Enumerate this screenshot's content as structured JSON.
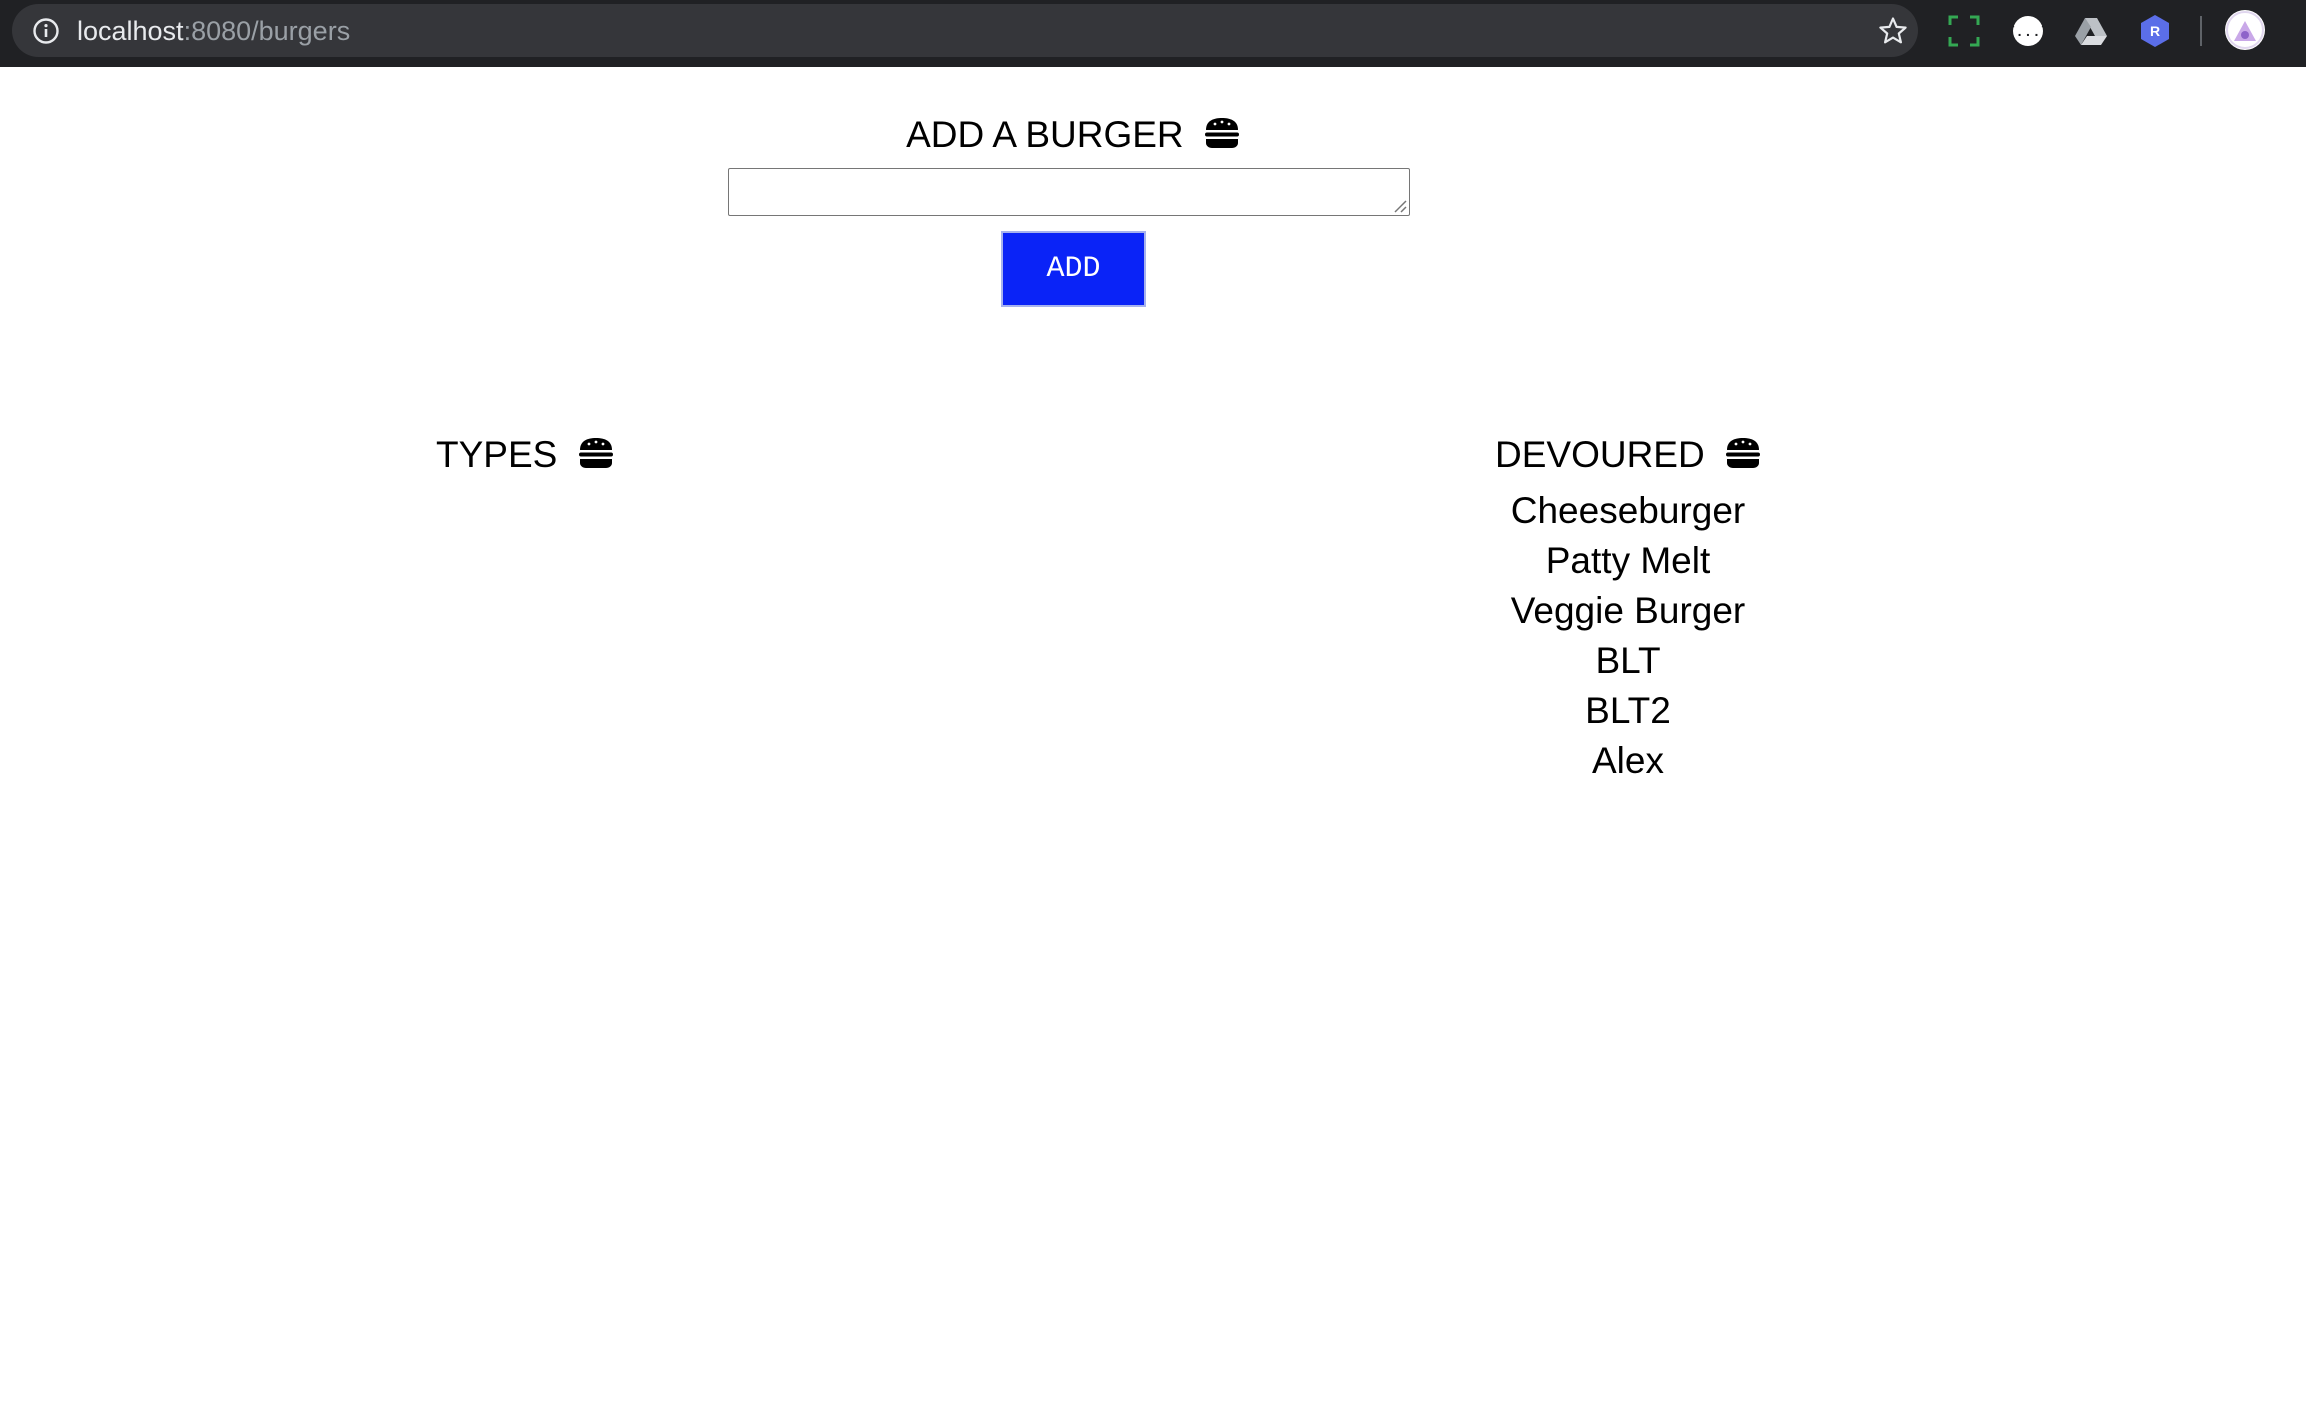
{
  "browser": {
    "url_host": "localhost",
    "url_path": ":8080/burgers",
    "extensions": [
      "screenshot-extension-icon",
      "json-viewer-icon",
      "google-drive-icon",
      "r-extension-icon"
    ],
    "extension_r_letter": "R",
    "accent_colors": {
      "chrome_bg": "#202124",
      "omnibox_bg": "#35363a",
      "ext_r": "#5b6ee8"
    }
  },
  "add_section": {
    "heading": "ADD A BURGER",
    "input_value": "",
    "button_label": "ADD",
    "button_color": "#0a23f7"
  },
  "types_section": {
    "heading": "TYPES",
    "items": []
  },
  "devoured_section": {
    "heading": "DEVOURED",
    "items": [
      "Cheeseburger",
      "Patty Melt",
      "Veggie Burger",
      "BLT",
      "BLT2",
      "Alex"
    ]
  }
}
